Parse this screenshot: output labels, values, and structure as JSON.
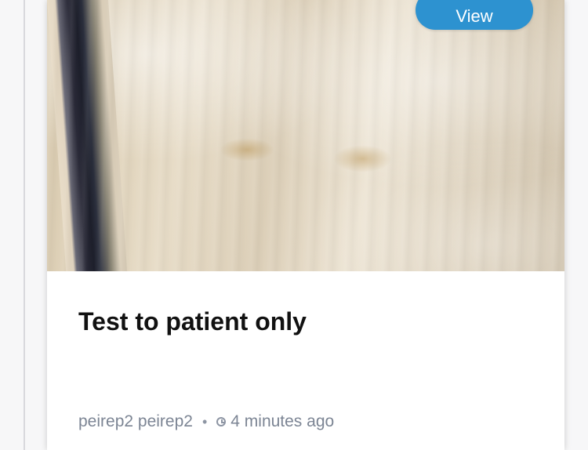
{
  "card": {
    "button_label": "View",
    "title": "Test to patient only",
    "author": "peirep2 peirep2",
    "separator": "•",
    "time_ago": "4 minutes ago"
  },
  "colors": {
    "accent": "#2d92d0",
    "title": "#111111",
    "meta": "#7c8594",
    "card_background": "#ffffff"
  },
  "icons": {
    "time": "clock-icon"
  }
}
